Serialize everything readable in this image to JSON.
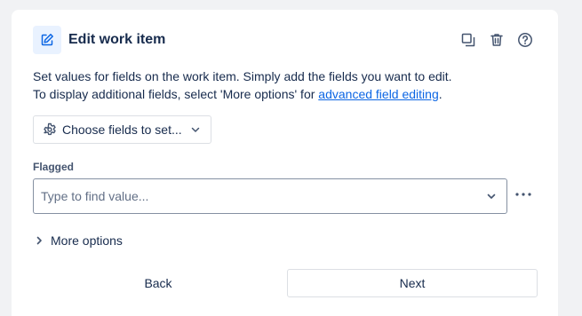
{
  "header": {
    "icon": "edit-icon",
    "title": "Edit work item",
    "actions": [
      {
        "icon": "duplicate-icon"
      },
      {
        "icon": "trash-icon"
      },
      {
        "icon": "help-icon"
      }
    ]
  },
  "description": {
    "line1": "Set values for fields on the work item. Simply add the fields you want to edit.",
    "line2_prefix": "To display additional fields, select 'More options' for ",
    "line2_link": "advanced field editing",
    "line2_suffix": "."
  },
  "choose_fields": {
    "icon": "gear-icon",
    "label": "Choose fields to set...",
    "chevron": "chevron-down-icon"
  },
  "flagged": {
    "label": "Flagged",
    "placeholder": "Type to find value...",
    "value": ""
  },
  "more_options": {
    "label": "More options",
    "icon": "chevron-right-icon"
  },
  "footer": {
    "back_label": "Back",
    "next_label": "Next"
  },
  "colors": {
    "accent": "#0c66e4",
    "text": "#172b4d",
    "subtle_text": "#626f86",
    "icon_bg": "#e9f2ff",
    "page_bg": "#f1f2f4"
  }
}
